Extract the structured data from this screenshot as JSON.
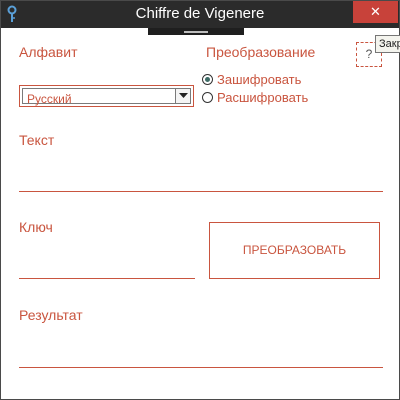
{
  "window": {
    "title": "Chiffre de Vigenere",
    "close_glyph": "✕",
    "icon": "key-icon"
  },
  "alphabet": {
    "label": "Алфавит",
    "selected": "Русский"
  },
  "transform": {
    "label": "Преобразование",
    "options": [
      {
        "label": "Зашифровать",
        "checked": true
      },
      {
        "label": "Расшифровать",
        "checked": false
      }
    ]
  },
  "help": {
    "label": "?",
    "tooltip": "Закрыть"
  },
  "text_field": {
    "label": "Текст",
    "value": ""
  },
  "key_field": {
    "label": "Ключ",
    "value": ""
  },
  "result_field": {
    "label": "Результат",
    "value": ""
  },
  "convert_button": {
    "label": "ПРЕОБРАЗОВАТЬ"
  },
  "colors": {
    "accent": "#c9553f",
    "titlebar": "#2b2b2b",
    "close": "#c8423a"
  }
}
